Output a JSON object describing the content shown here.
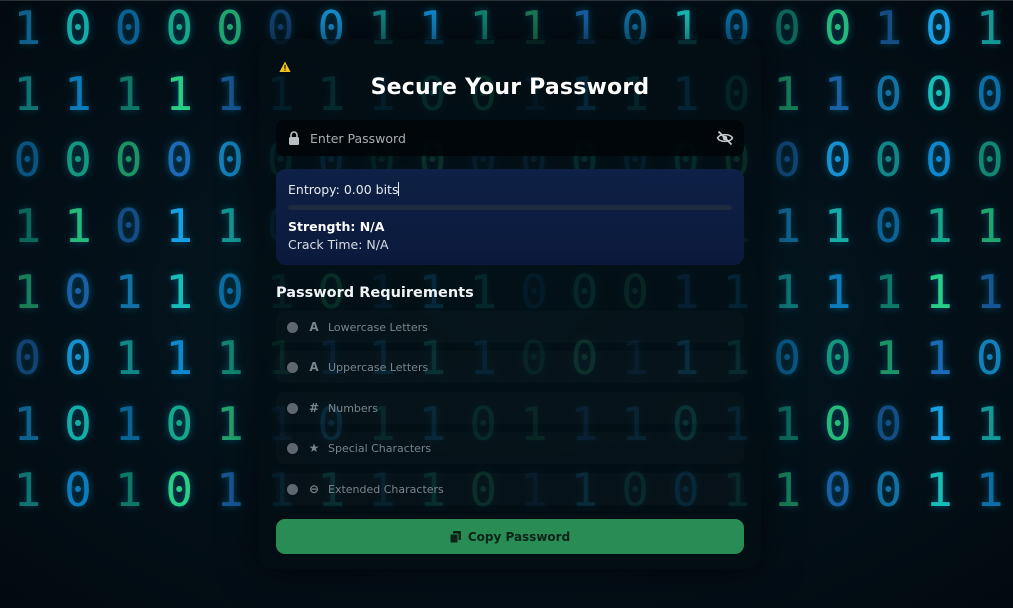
{
  "background": {
    "digit_columns": [
      "11011011",
      "01010000",
      "01001111",
      "01011100",
      "01010111",
      "01001111",
      "01010101",
      "11011111",
      "10011111",
      "10001100",
      "11010011",
      "11010011",
      "01010110",
      "11001100",
      "00011111",
      "01011011",
      "01011000",
      "10001100",
      "00011111",
      "10011011"
    ],
    "colors": [
      "#1aa7f0",
      "#19c8c0",
      "#0e8fd8",
      "#16b08f",
      "#2bd88c",
      "#1e6fc0"
    ]
  },
  "card": {
    "warning_icon": "warning-triangle-icon",
    "title": "Secure Your Password",
    "password_field": {
      "placeholder": "Enter Password",
      "value": "",
      "lock_icon": "lock-icon",
      "toggle_icon": "eye-slash-icon"
    },
    "entropy": {
      "entropy_text": "Entropy: 0.00 bits",
      "strength_percent": 0,
      "strength_text": "Strength: N/A",
      "crack_time_text": "Crack Time: N/A"
    },
    "requirements": {
      "heading": "Password Requirements",
      "items": [
        {
          "icon": "A",
          "label": "Lowercase Letters"
        },
        {
          "icon": "A",
          "label": "Uppercase Letters"
        },
        {
          "icon": "#",
          "label": "Numbers"
        },
        {
          "icon": "★",
          "label": "Special Characters"
        },
        {
          "icon": "⊖",
          "label": "Extended Characters"
        }
      ]
    },
    "copy_button": {
      "label": "Copy Password",
      "icon": "copy-icon",
      "color": "#2a8c55"
    }
  }
}
